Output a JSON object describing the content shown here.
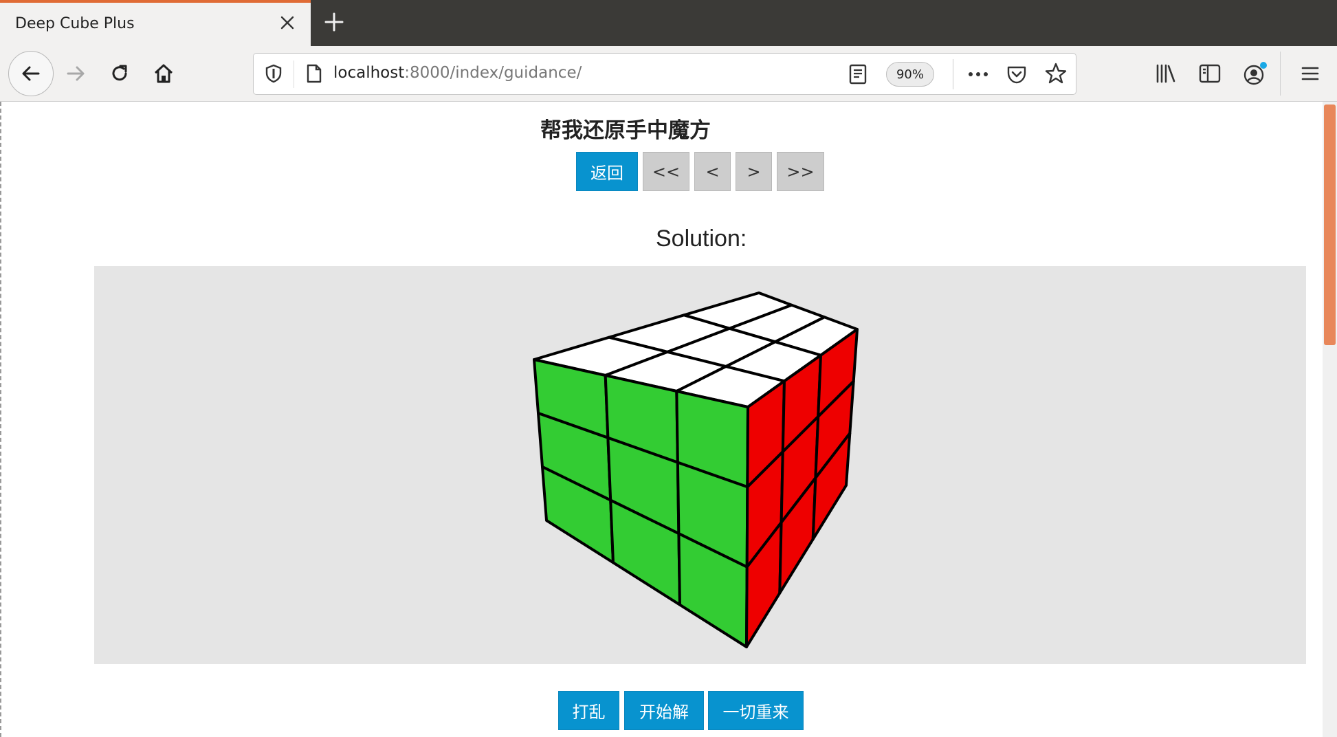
{
  "browser": {
    "tab_title": "Deep Cube Plus",
    "url_host": "localhost",
    "url_rest": ":8000/index/guidance/",
    "zoom": "90%"
  },
  "page": {
    "title": "帮我还原手中魔方",
    "nav_buttons": {
      "back": "返回",
      "first": "<<",
      "prev": "<",
      "next": ">",
      "last": ">>"
    },
    "solution_label": "Solution:",
    "cube": {
      "visible_faces": {
        "top": [
          "white",
          "white",
          "white",
          "white",
          "white",
          "white",
          "white",
          "white",
          "white"
        ],
        "front": [
          "green",
          "green",
          "green",
          "green",
          "green",
          "green",
          "green",
          "green",
          "green"
        ],
        "right": [
          "red",
          "red",
          "red",
          "red",
          "red",
          "red",
          "red",
          "red",
          "red"
        ]
      },
      "colors": {
        "white": "#ffffff",
        "green": "#33cc33",
        "red": "#ee0000",
        "outline": "#000000",
        "panel_bg": "#e5e5e5"
      }
    },
    "action_buttons": {
      "scramble": "打乱",
      "solve": "开始解",
      "reset": "一切重来"
    },
    "colors": {
      "primary_button": "#0893cf",
      "disabled_button": "#cdcdcd",
      "tab_accent": "#e06b35"
    }
  }
}
